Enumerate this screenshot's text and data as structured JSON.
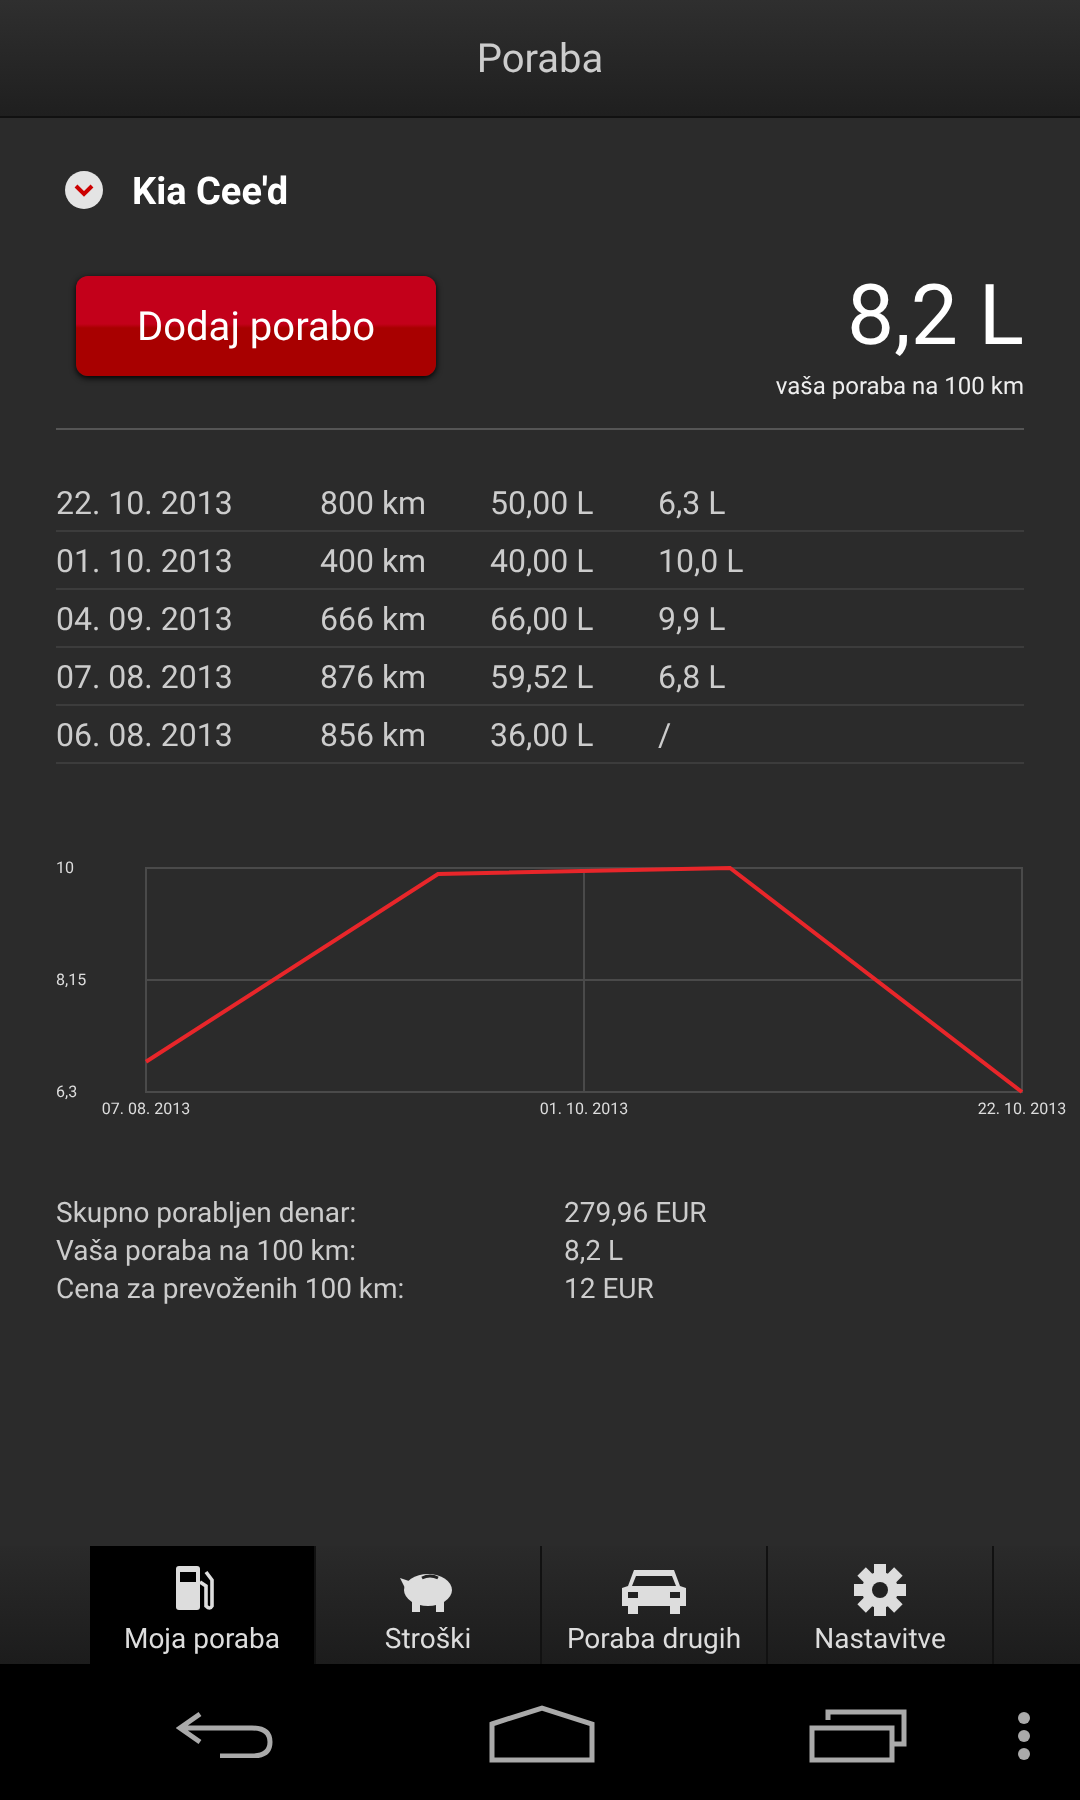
{
  "title_bar": {
    "title": "Poraba"
  },
  "vehicle": {
    "name": "Kia Cee'd"
  },
  "add_button": {
    "label": "Dodaj porabo"
  },
  "average": {
    "value": "8,2 L",
    "caption": "vaša poraba na 100 km"
  },
  "entries": [
    {
      "date": "22. 10. 2013",
      "distance": "800 km",
      "fuel": "50,00 L",
      "consumption": "6,3 L"
    },
    {
      "date": "01. 10. 2013",
      "distance": "400 km",
      "fuel": "40,00 L",
      "consumption": "10,0 L"
    },
    {
      "date": "04. 09. 2013",
      "distance": "666 km",
      "fuel": "66,00 L",
      "consumption": "9,9 L"
    },
    {
      "date": "07. 08. 2013",
      "distance": "876 km",
      "fuel": "59,52 L",
      "consumption": "6,8 L"
    },
    {
      "date": "06. 08. 2013",
      "distance": "856 km",
      "fuel": "36,00 L",
      "consumption": "/"
    }
  ],
  "chart": {
    "chart_data": {
      "type": "line",
      "categories": [
        "07. 08. 2013",
        null,
        null,
        "22. 10. 2013"
      ],
      "series": [
        {
          "color": "#e8262a",
          "values": [
            6.8,
            9.9,
            10.0,
            6.3
          ]
        }
      ],
      "ylim": [
        6.3,
        10
      ],
      "annotations": [
        "01. 10. 2013"
      ],
      "yticks": [
        {
          "value": 6.3,
          "label": "6,3"
        },
        {
          "value": 8.15,
          "label": "8,15"
        },
        {
          "value": 10,
          "label": "10"
        }
      ]
    }
  },
  "summary": [
    {
      "label": "Skupno porabljen denar:",
      "value": "279,96 EUR"
    },
    {
      "label": "Vaša poraba na 100 km:",
      "value": "8,2 L"
    },
    {
      "label": "Cena za prevoženih 100 km:",
      "value": "12 EUR"
    }
  ],
  "tabs": [
    {
      "kind": "fuel",
      "label": "Moja poraba",
      "selected": true
    },
    {
      "kind": "piggy",
      "label": "Stroški",
      "selected": false
    },
    {
      "kind": "car",
      "label": "Poraba drugih",
      "selected": false
    },
    {
      "kind": "gear",
      "label": "Nastavitve",
      "selected": false
    }
  ]
}
